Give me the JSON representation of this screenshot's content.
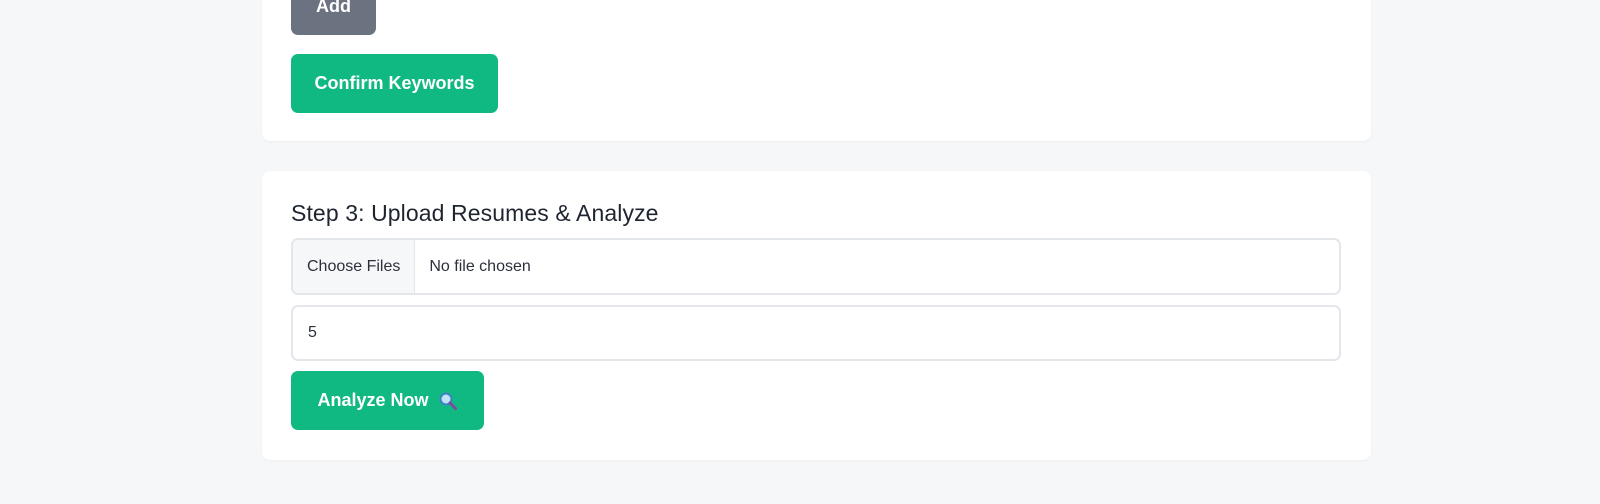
{
  "keywords_card": {
    "add_label": "Add",
    "confirm_label": "Confirm Keywords"
  },
  "step3": {
    "title": "Step 3: Upload Resumes & Analyze",
    "choose_files_label": "Choose Files",
    "file_status": "No file chosen",
    "count_value": "5",
    "analyze_label": "Analyze Now",
    "analyze_icon": "magnifying-glass-icon"
  },
  "colors": {
    "primary_green": "#10b981",
    "secondary_gray": "#6b7280",
    "page_bg": "#f6f7f9"
  }
}
